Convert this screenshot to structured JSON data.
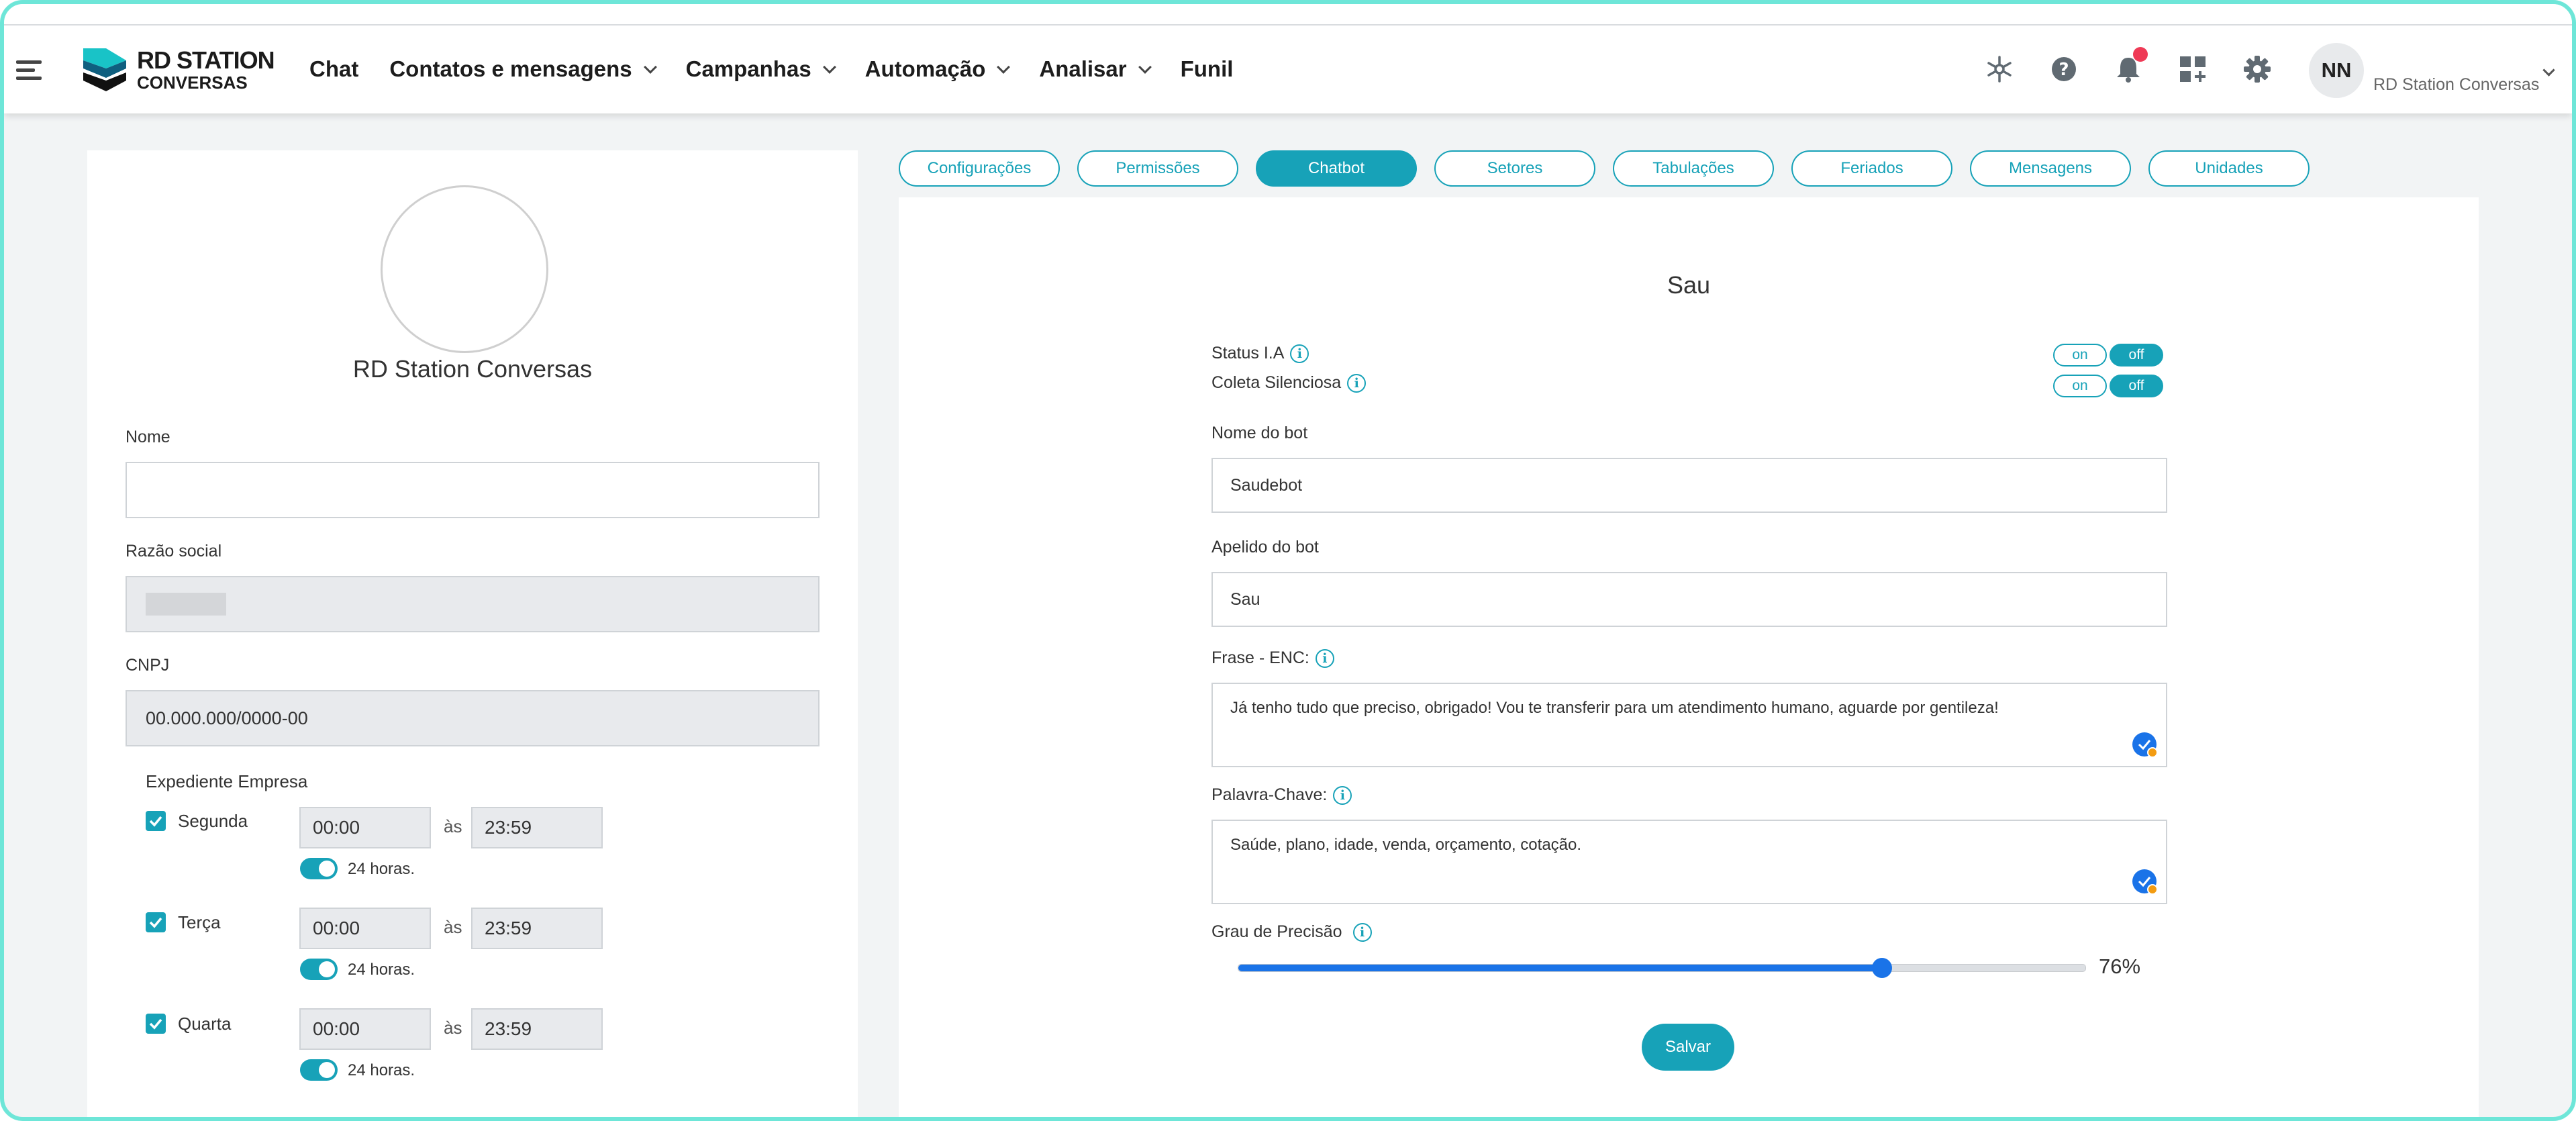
{
  "header": {
    "logo": {
      "line1": "RD STATION",
      "line2": "CONVERSAS"
    },
    "nav": [
      {
        "label": "Chat",
        "has_dropdown": false
      },
      {
        "label": "Contatos e mensagens",
        "has_dropdown": true
      },
      {
        "label": "Campanhas",
        "has_dropdown": true
      },
      {
        "label": "Automação",
        "has_dropdown": true
      },
      {
        "label": "Analisar",
        "has_dropdown": true
      },
      {
        "label": "Funil",
        "has_dropdown": false
      }
    ],
    "icons": [
      "integrations-icon",
      "help-icon",
      "notifications-icon",
      "add-app-icon",
      "settings-icon"
    ],
    "avatar_initials": "NN",
    "user_name": "RD Station Conversas"
  },
  "company": {
    "name": "RD Station Conversas",
    "fields": {
      "nome": {
        "label": "Nome",
        "value": ""
      },
      "razao": {
        "label": "Razão social",
        "value": ""
      },
      "cnpj": {
        "label": "CNPJ",
        "value": "00.000.000/0000-00"
      }
    },
    "expediente": {
      "title": "Expediente Empresa",
      "separator": "às",
      "full_day_label": "24 horas.",
      "days": [
        {
          "name": "Segunda",
          "start": "00:00",
          "end": "23:59"
        },
        {
          "name": "Terça",
          "start": "00:00",
          "end": "23:59"
        },
        {
          "name": "Quarta",
          "start": "00:00",
          "end": "23:59"
        }
      ]
    }
  },
  "tabs": [
    {
      "label": "Configurações",
      "active": false
    },
    {
      "label": "Permissões",
      "active": false
    },
    {
      "label": "Chatbot",
      "active": true
    },
    {
      "label": "Setores",
      "active": false
    },
    {
      "label": "Tabulações",
      "active": false
    },
    {
      "label": "Feriados",
      "active": false
    },
    {
      "label": "Mensagens",
      "active": false
    },
    {
      "label": "Unidades",
      "active": false
    }
  ],
  "chatbot": {
    "title": "Sau",
    "status_ia": {
      "label": "Status I.A",
      "on_label": "on",
      "off_label": "off",
      "value": "off"
    },
    "coleta": {
      "label": "Coleta Silenciosa",
      "on_label": "on",
      "off_label": "off",
      "value": "off"
    },
    "bot_name": {
      "label": "Nome do bot",
      "value": "Saudebot"
    },
    "bot_nick": {
      "label": "Apelido do bot",
      "value": "Sau"
    },
    "frase": {
      "label": "Frase - ENC:",
      "value": "Já tenho tudo que preciso, obrigado! Vou te transferir para um atendimento humano, aguarde por gentileza!"
    },
    "keywords": {
      "label": "Palavra-Chave:",
      "value": "Saúde, plano, idade, venda, orçamento, cotação."
    },
    "precision": {
      "label": "Grau de Precisão",
      "value": 76,
      "display": "76%"
    },
    "save_label": "Salvar"
  },
  "colors": {
    "accent": "#17a2b8",
    "slider": "#1a73e8",
    "badge": "#ef3a56"
  }
}
